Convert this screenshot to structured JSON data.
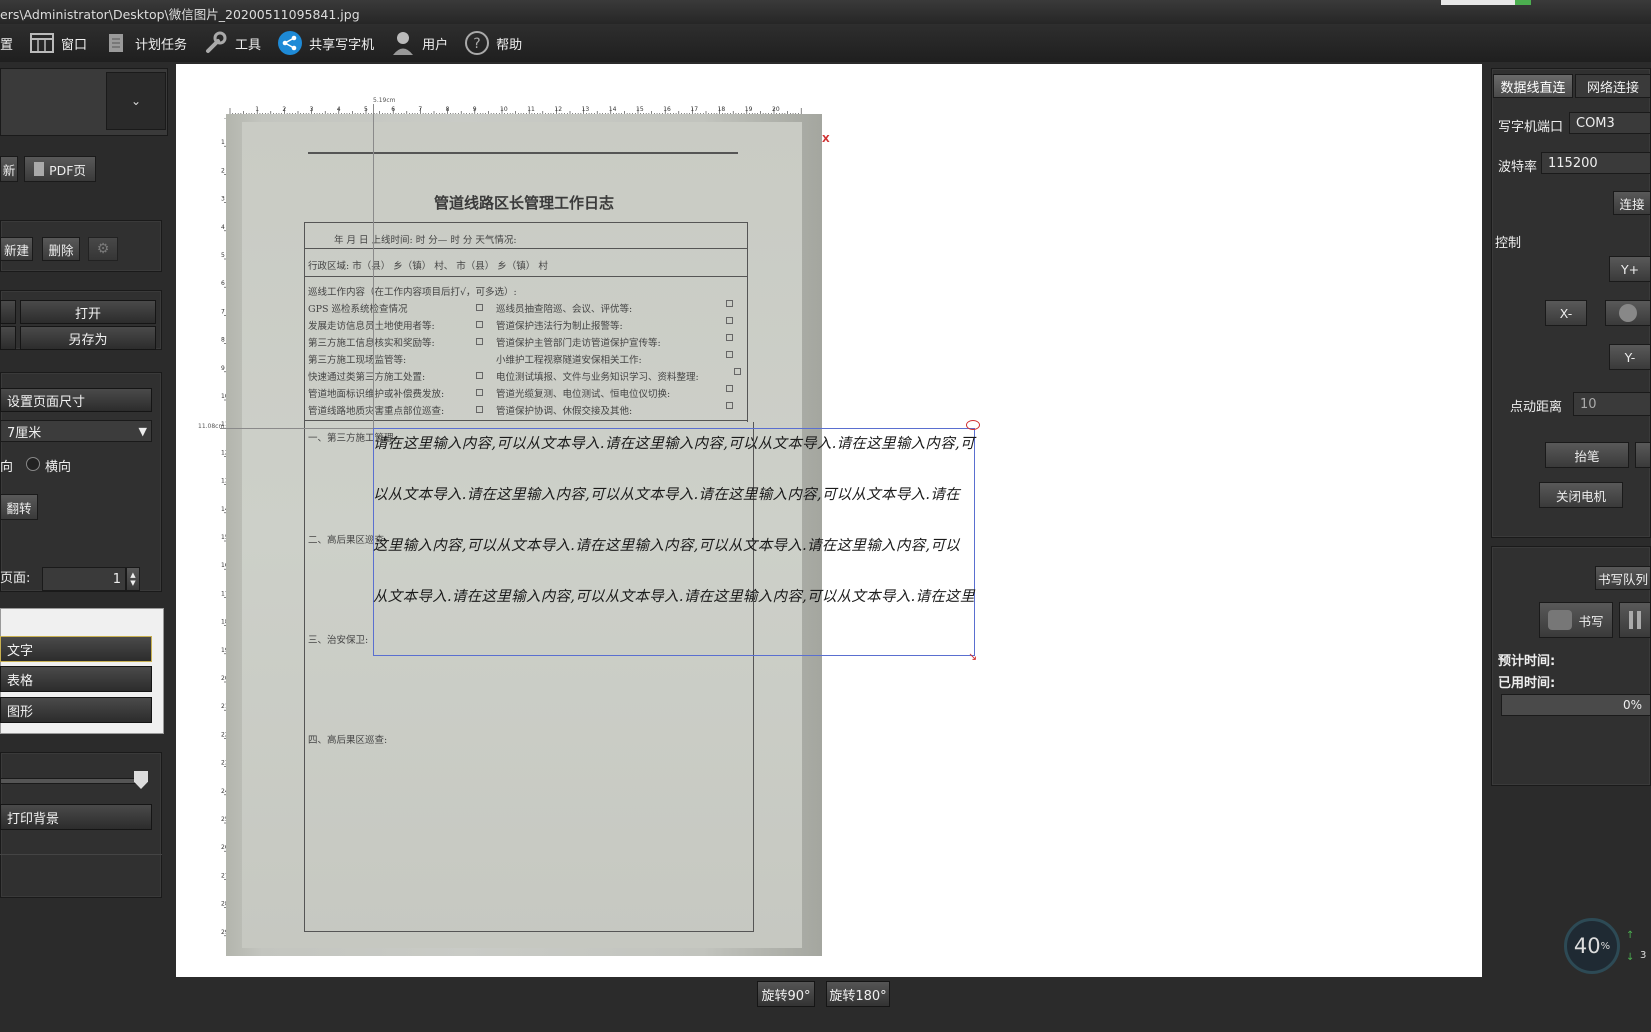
{
  "window": {
    "title": "ers\\Administrator\\Desktop\\微信图片_20200511095841.jpg"
  },
  "menubar": {
    "items": [
      {
        "label": "置",
        "icon": "settings-icon"
      },
      {
        "label": "窗口",
        "icon": "window-icon"
      },
      {
        "label": "计划任务",
        "icon": "scroll-icon"
      },
      {
        "label": "工具",
        "icon": "wrench-icon"
      },
      {
        "label": "共享写字机",
        "icon": "share-icon"
      },
      {
        "label": "用户",
        "icon": "user-icon"
      },
      {
        "label": "帮助",
        "icon": "help-icon"
      }
    ]
  },
  "left": {
    "new_page": "新",
    "pdf_page": "PDF页",
    "new_btn": "新建",
    "delete_btn": "删除",
    "open_btn": "打开",
    "save_as_btn": "另存为",
    "page_size_btn": "设置页面尺寸",
    "page_size_value": "7厘米",
    "orient_portrait": "向",
    "orient_landscape": "横向",
    "flip_btn": "翻转",
    "page_label": "页面:",
    "page_value": "1",
    "tools": [
      "文字",
      "表格",
      "图形"
    ],
    "print_bg_btn": "打印背景"
  },
  "canvas": {
    "ruler_top_marker": "5.19cm",
    "ruler_left_marker": "11.08cm",
    "ruler_top_numbers": [
      "1",
      "2",
      "3",
      "4",
      "5",
      "6",
      "7",
      "8",
      "9",
      "10",
      "11",
      "12",
      "13",
      "14",
      "15",
      "16",
      "17",
      "18",
      "19",
      "20"
    ],
    "ruler_left_numbers": [
      "1",
      "2",
      "3",
      "4",
      "5",
      "6",
      "7",
      "8",
      "9",
      "10",
      "11",
      "12",
      "13",
      "14",
      "15",
      "16",
      "17",
      "18",
      "19",
      "20",
      "21",
      "22",
      "23",
      "24",
      "25",
      "26",
      "27",
      "28",
      "29"
    ],
    "x_marker": "X",
    "doc_title": "管道线路区长管理工作日志",
    "doc_row1": "年    月    日      上线时间:      时      分—      时      分         天气情况:",
    "doc_row2": "行政区域:           市（县）        乡（镇）        村、      市（县）        乡（镇）         村",
    "doc_lines": [
      "巡线工作内容（在工作内容项目后打√，可多选）:",
      "GPS 巡检系统检查情况",
      "发展走访信息员土地使用者等:",
      "第三方施工信息核实和奖励等:",
      "第三方施工现场监管等:",
      "快速通过类第三方施工处置:",
      "管道地面标识维护或补偿费发放:",
      "管道线路地质灾害重点部位巡查:"
    ],
    "doc_lines_right": [
      "巡线员抽查陪巡、会议、评优等:",
      "管道保护违法行为制止报警等:",
      "管道保护主管部门走访管道保护宣传等:",
      "小维护工程视察隧道安保相关工作:",
      "电位测试填报、文件与业务知识学习、资料整理:",
      "管道光缆复测、电位测试、恒电位仪切换:",
      "管道保护协调、休假交接及其他:"
    ],
    "doc_sections": [
      "一、第三方施工管理:",
      "二、高后果区巡查:",
      "三、治安保卫:",
      "四、高后果区巡查:"
    ],
    "handwriting": [
      "请在这里输入内容,可以从文本导入.请在这里输入内容,可以从文本导入.请在这里输入内容,可",
      "以从文本导入.请在这里输入内容,可以从文本导入.请在这里输入内容,可以从文本导入.请在",
      "这里输入内容,可以从文本导入.请在这里输入内容,可以从文本导入.请在这里输入内容,可以",
      "从文本导入.请在这里输入内容,可以从文本导入.请在这里输入内容,可以从文本导入.请在这里"
    ]
  },
  "bottom": {
    "rotate90": "旋转90°",
    "rotate180": "旋转180°"
  },
  "right": {
    "tab_serial": "数据线直连",
    "tab_network": "网络连接",
    "port_label": "写字机端口",
    "port_value": "COM3",
    "baud_label": "波特率",
    "baud_value": "115200",
    "connect_btn": "连接",
    "control_label": "控制",
    "y_plus": "Y+",
    "x_minus": "X-",
    "y_minus": "Y-",
    "step_label": "点动距离",
    "step_value": "10",
    "pen_up_btn": "抬笔",
    "motor_off_btn": "关闭电机",
    "queue_btn": "书写队列",
    "write_btn": "书写",
    "eta_label": "预计时间:",
    "elapsed_label": "已用时间:",
    "progress_text": "0%",
    "progress": 0
  },
  "gauge": {
    "percent": "40",
    "unit": "%",
    "extra": "3"
  },
  "colors": {
    "accent_blue": "#5a6fd0",
    "marker_red": "#d03030",
    "bg_dark": "#2b2b2b"
  }
}
